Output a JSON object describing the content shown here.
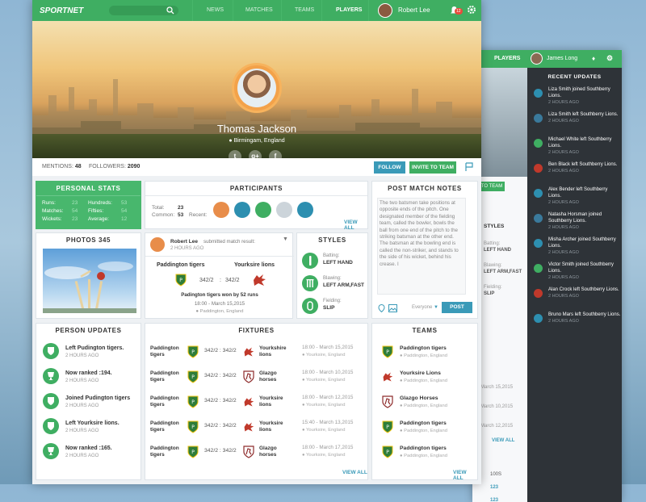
{
  "app": {
    "logo": "SPORTNET"
  },
  "nav": {
    "links": [
      "NEWS",
      "MATCHES",
      "TEAMS",
      "PLAYERS"
    ],
    "user_name": "Robert Lee",
    "notification_count": "12"
  },
  "profile": {
    "name": "Thomas Jackson",
    "location": "Birmingam, England",
    "mentions_label": "MENTIONS:",
    "mentions": "48",
    "followers_label": "FOLLOWERS:",
    "followers": "2090",
    "follow_label": "FOLLOW",
    "invite_label": "INVITE TO TEAM"
  },
  "personal_stats": {
    "title": "PERSONAL STATS",
    "left": [
      {
        "label": "Runs:",
        "value": "23"
      },
      {
        "label": "Matches:",
        "value": "54"
      },
      {
        "label": "Wickets:",
        "value": "23"
      }
    ],
    "right": [
      {
        "label": "Hundreds:",
        "value": "53"
      },
      {
        "label": "Fifties:",
        "value": "54"
      },
      {
        "label": "Average:",
        "value": "12"
      }
    ]
  },
  "photos": {
    "title": "PHOTOS 345"
  },
  "participants": {
    "title": "PARTICIPANTS",
    "total_label": "Total:",
    "total": "23",
    "common_label": "Common:",
    "common": "53",
    "recent_label": "Recent:",
    "view_all": "VIEW ALL"
  },
  "match_post": {
    "user": "Robert Lee",
    "action": "submitted match result:",
    "time": "2 HOURS AGO",
    "home": "Paddington tigers",
    "away": "Yourksire lions",
    "score_home": "342/2",
    "score_away": "342/2",
    "result": "Padington tigers won by 52 runs",
    "date": "18:00 - March 15,2015",
    "place": "Paddington, England"
  },
  "styles": {
    "title": "STYLES",
    "items": [
      {
        "label": "Batting:",
        "value": "LEFT HAND"
      },
      {
        "label": "Blawing:",
        "value": "LEFT ARM,FAST"
      },
      {
        "label": "Fielding:",
        "value": "SLIP"
      }
    ]
  },
  "notes": {
    "title": "POST MATCH NOTES",
    "text": "The two batsmen take positions at opposite ends of the pitch. One designated member of the fielding team, called the bowler, bowls the ball from one end of the pitch to the striking batsman at the other end. The batsman at the bowling end is called the non-striker, and stands to the side of his wicket, behind his crease. I",
    "audience": "Everyone",
    "post_label": "POST"
  },
  "person_updates": {
    "title": "PERSON UPDATES",
    "items": [
      {
        "text": "Left Pudington tigers.",
        "time": "2 HOURS AGO",
        "icon": "shield-icon"
      },
      {
        "text": "Now ranked :194.",
        "time": "2 HOURS AGO",
        "icon": "trophy-icon"
      },
      {
        "text": "Joined Pudington tigers",
        "time": "2 HOURS AGO",
        "icon": "shield-icon"
      },
      {
        "text": "Left Yourksire lions.",
        "time": "2 HOURS AGO",
        "icon": "shield-icon"
      },
      {
        "text": "Now ranked :165.",
        "time": "2 HOURS AGO",
        "icon": "trophy-icon"
      }
    ]
  },
  "fixtures": {
    "title": "FIXTURES",
    "view_all": "VIEW ALL",
    "items": [
      {
        "home": "Paddington tigers",
        "score": "342/2  :  342/2",
        "away": "Yourkshire lions",
        "date": "18:00 - March 15,2015",
        "place": "Yourksire, England"
      },
      {
        "home": "Paddington tigers",
        "score": "342/2  :  342/2",
        "away": "Glazgo horses",
        "date": "18:00 - March 10,2015",
        "place": "Yourksire, England"
      },
      {
        "home": "Paddington tigers",
        "score": "342/2  :  342/2",
        "away": "Yourksire lions",
        "date": "18:00 - March 12,2015",
        "place": "Yourksire, England"
      },
      {
        "home": "Paddington tigers",
        "score": "342/2  :  342/2",
        "away": "Yourksire lions",
        "date": "15:40 - March 13,2015",
        "place": "Yourksire, England"
      },
      {
        "home": "Paddington tigers",
        "score": "342/2  :  342/2",
        "away": "Glazgo horses",
        "date": "18:00 - March 17,2015",
        "place": "Yourksire, England"
      }
    ]
  },
  "teams": {
    "title": "TEAMS",
    "view_all": "VIEW ALL",
    "items": [
      {
        "name": "Paddington tigers",
        "place": "Paddington, England"
      },
      {
        "name": "Yourksire Lions",
        "place": "Paddington, England"
      },
      {
        "name": "Glazgo Horses",
        "place": "Paddington, England"
      },
      {
        "name": "Paddington tigers",
        "place": "Paddington, England"
      },
      {
        "name": "Paddington tigers",
        "place": "Paddington, England"
      }
    ]
  },
  "back_window": {
    "nav_link": "PLAYERS",
    "user_name": "James Long",
    "invite_label": "TO TEAM",
    "styles_title": "STYLES",
    "style_labels": [
      "Batting:",
      "Blawing:",
      "Fielding:"
    ],
    "style_values": [
      "LEFT HAND",
      "LEFT ARM,FAST",
      "SLIP"
    ],
    "date_fragments": [
      "March 15,2015",
      "March 10,2015",
      "March 12,2015",
      "March 13,2015",
      "March 17,2015"
    ],
    "view_all": "VIEW ALL",
    "stat_head": "100S",
    "stat_value": "123",
    "recent_updates": {
      "title": "RECENT UPDATES",
      "items": [
        {
          "text": "Liza Smith joined Southberry Lions.",
          "time": "2 HOURS AGO",
          "color": "#2d8fb0"
        },
        {
          "text": "Liza Smith left Southberry Lions.",
          "time": "2 HOURS AGO",
          "color": "#3a7a9c"
        },
        {
          "text": "Michael White left Southberry Lions.",
          "time": "2 HOURS AGO",
          "color": "#3fae62"
        },
        {
          "text": "Ben Black left Southberry Lions.",
          "time": "2 HOURS AGO",
          "color": "#c0392b"
        },
        {
          "text": "Alex Bender left Southberry Lions.",
          "time": "2 HOURS AGO",
          "color": "#2d8fb0"
        },
        {
          "text": "Natasha Horsman joined Southberry Lions.",
          "time": "2 HOURS AGO",
          "color": "#3a7a9c"
        },
        {
          "text": "Misha Archer joined Southberry Lions.",
          "time": "2 HOURS AGO",
          "color": "#2d8fb0"
        },
        {
          "text": "Victor Smith joined Southberry Lions.",
          "time": "2 HOURS AGO",
          "color": "#3fae62"
        },
        {
          "text": "Alan Crock left Southberry Lions.",
          "time": "2 HOURS AGO",
          "color": "#c0392b"
        },
        {
          "text": "Bruno Mars left Southberry Lions.",
          "time": "2 HOURS AGO",
          "color": "#2d8fb0"
        }
      ]
    }
  },
  "colors": {
    "accent": "#3fae62",
    "secondary": "#3a9ab8",
    "dark_panel": "#2e3338"
  }
}
